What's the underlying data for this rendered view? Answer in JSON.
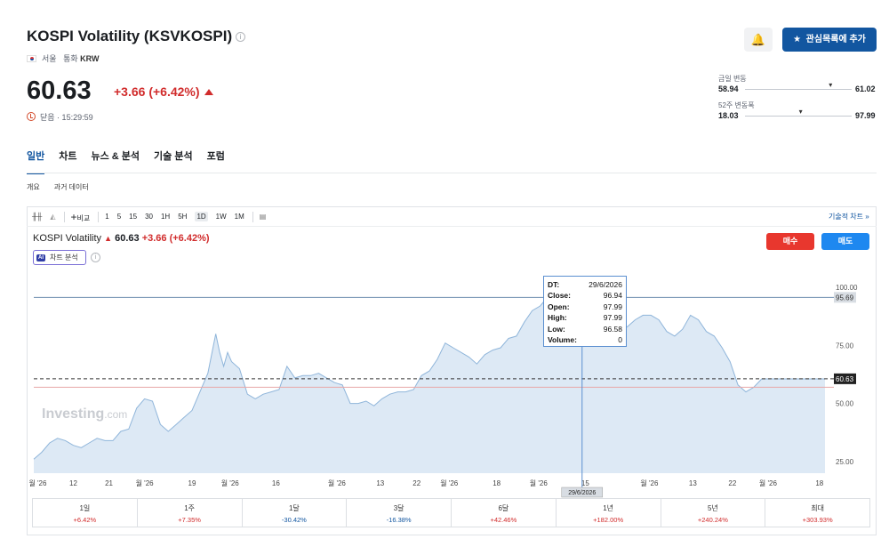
{
  "header": {
    "title": "KOSPI Volatility (KSVKOSPI)",
    "exchange": "서울",
    "currency_label": "통화",
    "currency": "KRW",
    "price": "60.63",
    "change": "+3.66 (+6.42%)",
    "status": "닫음 · 15:29:59",
    "watchlist_label": "관심목록에 추가",
    "colors": {
      "up": "#d12c2c",
      "down": "#1256a0",
      "brand": "#1256a0"
    }
  },
  "ranges": {
    "day": {
      "label": "금일 변동",
      "low": "58.94",
      "high": "61.02",
      "position": 0.81
    },
    "week52": {
      "label": "52주 변동폭",
      "low": "18.03",
      "high": "97.99",
      "position": 0.53
    }
  },
  "tabs": [
    "일반",
    "차트",
    "뉴스 & 분석",
    "기술 분석",
    "포럼"
  ],
  "subtabs": [
    "개요",
    "과거 데이터"
  ],
  "toolbar": {
    "compare_label": "비교",
    "intervals": [
      "1",
      "5",
      "15",
      "30",
      "1H",
      "5H",
      "1D",
      "1W",
      "1M"
    ],
    "selected_interval": "1D",
    "technical_chart_label": "기술적 차트 »"
  },
  "legend": {
    "name": "KOSPI Volatility",
    "price": "60.63",
    "change": "+3.66 (+6.42%)"
  },
  "ai_label": "차트 분석",
  "sell_label": "매수",
  "buy_label": "매도",
  "watermark": {
    "main": "Investing",
    "suffix": ".com"
  },
  "tooltip": [
    {
      "k": "DT:",
      "v": "29/6/2026"
    },
    {
      "k": "Close:",
      "v": "96.94"
    },
    {
      "k": "Open:",
      "v": "97.99"
    },
    {
      "k": "High:",
      "v": "97.99"
    },
    {
      "k": "Low:",
      "v": "96.58"
    },
    {
      "k": "Volume:",
      "v": "0"
    }
  ],
  "performance": [
    {
      "period": "1일",
      "value": "+6.42%",
      "dir": "pos"
    },
    {
      "period": "1주",
      "value": "+7.35%",
      "dir": "pos"
    },
    {
      "period": "1달",
      "value": "-30.42%",
      "dir": "neg"
    },
    {
      "period": "3달",
      "value": "-16.38%",
      "dir": "neg"
    },
    {
      "period": "6달",
      "value": "+42.46%",
      "dir": "pos"
    },
    {
      "period": "1년",
      "value": "+182.00%",
      "dir": "pos"
    },
    {
      "period": "5년",
      "value": "+240.24%",
      "dir": "pos"
    },
    {
      "period": "최대",
      "value": "+303.93%",
      "dir": "pos"
    }
  ],
  "chart_data": {
    "type": "area",
    "y_ticks": [
      100,
      75,
      50,
      25
    ],
    "y_tick_labels": [
      "100.00",
      "75.00",
      "50.00",
      "25.00"
    ],
    "ylim": [
      20,
      105
    ],
    "x_tick_labels": [
      "월 '26",
      "12",
      "21",
      "월 '26",
      "19",
      "월 '26",
      "16",
      "월 '26",
      "13",
      "22",
      "월 '26",
      "18",
      "월 '26",
      "15",
      "월 '26",
      "13",
      "22",
      "월 '26",
      "18"
    ],
    "x_tick_positions": [
      0.005,
      0.05,
      0.095,
      0.14,
      0.2,
      0.248,
      0.306,
      0.383,
      0.438,
      0.484,
      0.525,
      0.585,
      0.638,
      0.697,
      0.778,
      0.833,
      0.883,
      0.928,
      0.993
    ],
    "series": [
      {
        "color": "#8fb5da",
        "fill": "#dde9f5",
        "x": [
          0,
          0.01,
          0.02,
          0.03,
          0.04,
          0.05,
          0.06,
          0.07,
          0.08,
          0.09,
          0.1,
          0.11,
          0.12,
          0.13,
          0.14,
          0.15,
          0.16,
          0.17,
          0.18,
          0.19,
          0.2,
          0.21,
          0.22,
          0.23,
          0.235,
          0.24,
          0.245,
          0.25,
          0.26,
          0.27,
          0.28,
          0.29,
          0.3,
          0.31,
          0.32,
          0.33,
          0.34,
          0.35,
          0.36,
          0.37,
          0.38,
          0.39,
          0.4,
          0.41,
          0.42,
          0.43,
          0.44,
          0.45,
          0.46,
          0.47,
          0.48,
          0.49,
          0.5,
          0.51,
          0.52,
          0.53,
          0.54,
          0.55,
          0.56,
          0.57,
          0.58,
          0.59,
          0.6,
          0.61,
          0.62,
          0.63,
          0.64,
          0.65,
          0.66,
          0.67,
          0.68,
          0.69,
          0.7,
          0.71,
          0.72,
          0.73,
          0.74,
          0.75,
          0.76,
          0.77,
          0.78,
          0.79,
          0.8,
          0.81,
          0.82,
          0.83,
          0.84,
          0.85,
          0.86,
          0.87,
          0.88,
          0.89,
          0.9,
          0.91,
          0.92,
          0.93,
          0.94,
          0.95,
          0.96,
          0.97,
          0.98,
          0.99,
          1.0
        ],
        "y": [
          26,
          29,
          33,
          35,
          34,
          32,
          31,
          33,
          35,
          34,
          34,
          38,
          39,
          48,
          52,
          51,
          41,
          38,
          41,
          44,
          47,
          55,
          63,
          80,
          72,
          66,
          72,
          68,
          65,
          54,
          52,
          54,
          55,
          56,
          66,
          61,
          62,
          62,
          63,
          61,
          59,
          58,
          50,
          50,
          51,
          49,
          52,
          54,
          55,
          55,
          56,
          62,
          64,
          69,
          76,
          74,
          72,
          70,
          67,
          71,
          73,
          74,
          78,
          79,
          85,
          90,
          92,
          96,
          97,
          95,
          93,
          87,
          85,
          89,
          92,
          87,
          82,
          83,
          86,
          88,
          88,
          86,
          81,
          79,
          82,
          88,
          86,
          81,
          79,
          74,
          68,
          58,
          55,
          57,
          60.6,
          60.6,
          60.6,
          60.6,
          60.6,
          60.6,
          60.6,
          60.6,
          60.6
        ]
      }
    ],
    "horizontal_lines": [
      {
        "value": 95.69,
        "label": "95.69",
        "style": "solid",
        "color": "#6f8fb0"
      },
      {
        "value": 60.63,
        "label": "60.63",
        "style": "dashed",
        "color": "#333333"
      },
      {
        "value": 57.0,
        "style": "solid",
        "color": "#e8a8a8"
      }
    ],
    "crosshair": {
      "x": 0.693,
      "label": "29/6/2026"
    }
  }
}
